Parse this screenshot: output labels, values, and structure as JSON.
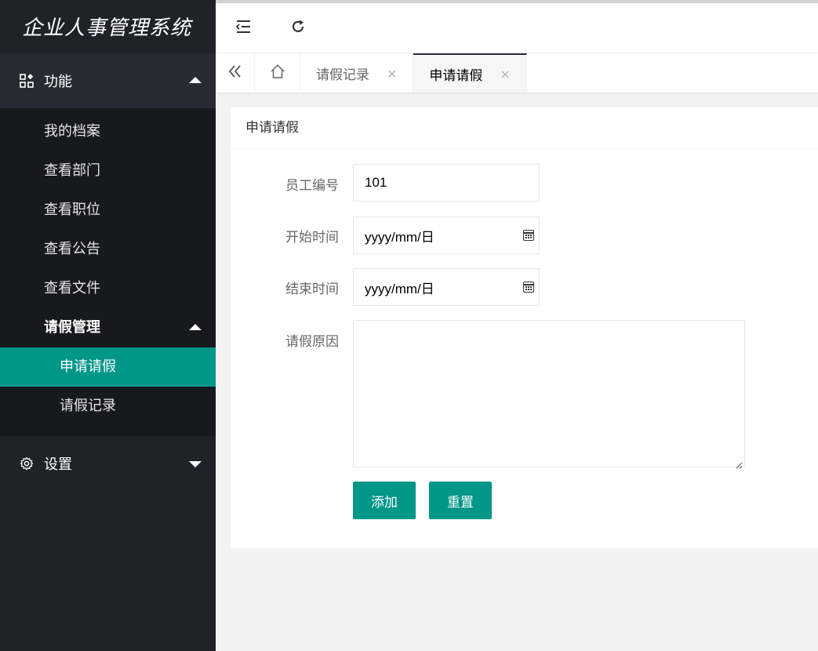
{
  "app": {
    "title": "企业人事管理系统"
  },
  "sidebar": {
    "groups": [
      {
        "label": "功能",
        "icon": "grid-icon",
        "expanded": true
      },
      {
        "label": "设置",
        "icon": "gear-icon",
        "expanded": false
      }
    ],
    "items": [
      {
        "label": "我的档案"
      },
      {
        "label": "查看部门"
      },
      {
        "label": "查看职位"
      },
      {
        "label": "查看公告"
      },
      {
        "label": "查看文件"
      }
    ],
    "leave_group": {
      "label": "请假管理"
    },
    "leave_items": [
      {
        "label": "申请请假",
        "active": true
      },
      {
        "label": "请假记录"
      }
    ]
  },
  "topbar": {
    "icons": [
      "shrink-menu-icon",
      "refresh-icon"
    ]
  },
  "tabs": {
    "items": [
      {
        "label": "请假记录",
        "close": "×"
      },
      {
        "label": "申请请假",
        "close": "×",
        "active": true
      }
    ]
  },
  "form": {
    "title": "申请请假",
    "employee_id": {
      "label": "员工编号",
      "value": "101"
    },
    "start_time": {
      "label": "开始时间",
      "placeholder": "yyyy/mm/日"
    },
    "end_time": {
      "label": "结束时间",
      "placeholder": "yyyy/mm/日"
    },
    "reason": {
      "label": "请假原因",
      "value": ""
    },
    "buttons": {
      "add": "添加",
      "reset": "重置"
    }
  },
  "colors": {
    "accent": "#009688",
    "sidebar_bg": "#20222a",
    "submenu_bg": "#18191e"
  }
}
